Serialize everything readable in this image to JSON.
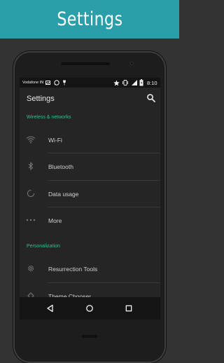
{
  "banner": {
    "title": "Settings"
  },
  "status_bar": {
    "carrier": "Vodafone IN",
    "time": "8:10"
  },
  "app_bar": {
    "title": "Settings",
    "search_icon": "search-icon"
  },
  "sections": [
    {
      "header": "Wireless & networks",
      "items": [
        {
          "label": "Wi-Fi",
          "icon": "wifi-icon"
        },
        {
          "label": "Bluetooth",
          "icon": "bluetooth-icon"
        },
        {
          "label": "Data usage",
          "icon": "data-usage-icon"
        },
        {
          "label": "More",
          "icon": "more-dots-icon"
        }
      ]
    },
    {
      "header": "Personalization",
      "items": [
        {
          "label": "Resurrection Tools",
          "icon": "gear-icon"
        },
        {
          "label": "Theme Chooser",
          "icon": "paint-bucket-icon"
        }
      ]
    }
  ],
  "nav_bar": {
    "back": "back-triangle-icon",
    "home": "home-circle-icon",
    "recents": "recents-square-icon"
  },
  "colors": {
    "banner": "#2a9ea9",
    "section_header": "#24c695",
    "screen_bg": "#252525",
    "page_bg": "#333333"
  }
}
